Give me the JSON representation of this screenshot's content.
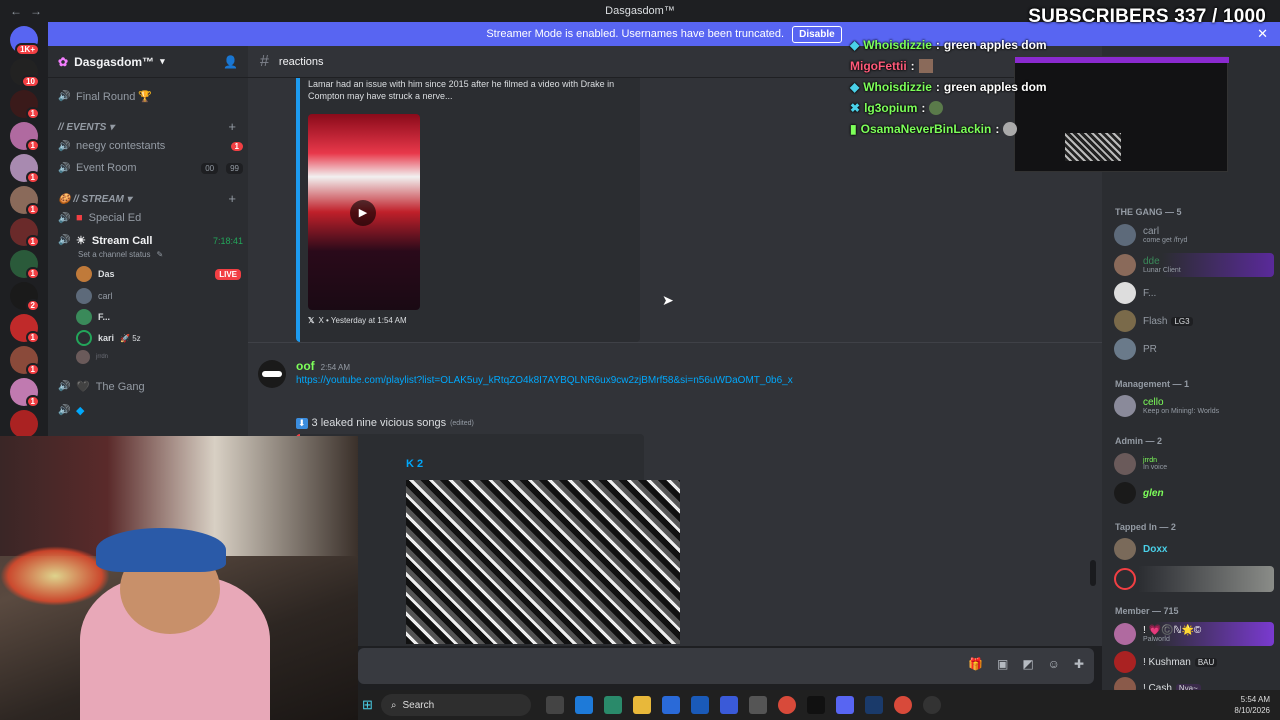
{
  "window": {
    "title": "Dasgasdom™"
  },
  "banner": {
    "text": "Streamer Mode is enabled. Usernames have been truncated.",
    "button": "Disable"
  },
  "overlay": {
    "subscribers": "SUBSCRIBERS 337 / 1000"
  },
  "rail": {
    "badges": [
      "1K+",
      "10",
      "1",
      "1",
      "1",
      "1",
      "1",
      "1",
      "2",
      "1",
      "1",
      "1",
      "2",
      "1",
      "1"
    ]
  },
  "server": {
    "name": "Dasgasdom™"
  },
  "channels": {
    "final_round": "Final Round 🏆",
    "events_cat": "// Events",
    "neegy": "neegy contestants",
    "neegy_badge": "1",
    "event_room": "Event Room",
    "event_room_count_a": "00",
    "event_room_count_b": "99",
    "stream_cat": "// STREAM",
    "special_ed": "Special Ed",
    "stream_call": "Stream Call",
    "stream_call_time": "7:18:41",
    "status_hint": "Set a channel status",
    "the_gang": "The Gang"
  },
  "voice_users": {
    "das": "Das",
    "live": "LIVE",
    "carl": "carl",
    "f": "F...",
    "kari": "kari",
    "kari_tag": "🚀 5z",
    "jrrdn": "jrrdn"
  },
  "chat": {
    "channel": "reactions",
    "embed_text_1": "Lamar had an issue with him since 2015 after he filmed a video with Drake in",
    "embed_text_2": "Compton may have struck a nerve...",
    "embed_footer": "X • Yesterday at 1:54 AM",
    "msg_author": "oof",
    "msg_time": "2:54 AM",
    "msg_link": "https://youtube.com/playlist?list=OLAK5uy_kRtqZO4k8I7AYBQLNR6ux9cw2zjBMrf58&si=n56uWDaOMT_0b6_x",
    "msg2_text": "3 leaked nine vicious songs",
    "msg2_edited": "(edited)",
    "embed2_title": "K 2"
  },
  "stream_chat": [
    {
      "user": "Whoisdizzie",
      "text": "green apples dom",
      "color": "#7dff5a"
    },
    {
      "user": "MigoFettii",
      "text": "",
      "color": "#ff5a7a"
    },
    {
      "user": "Whoisdizzie",
      "text": "green apples dom",
      "color": "#7dff5a"
    },
    {
      "user": "lg3opium",
      "text": "",
      "color": "#7dff5a"
    },
    {
      "user": "OsamaNeverBinLackin",
      "text": "",
      "color": "#7dff5a"
    }
  ],
  "members": {
    "gang_cat": "THE GANG — 5",
    "gang": [
      {
        "name": "carl",
        "sub": "come get /fryd"
      },
      {
        "name": "dde",
        "sub": "Lunar Client"
      },
      {
        "name": "F...",
        "sub": ""
      },
      {
        "name": "Flash",
        "sub": "LG3"
      },
      {
        "name": "PR",
        "sub": ""
      }
    ],
    "mgmt_cat": "Management — 1",
    "cello": "cello",
    "cello_sub": "Keep on Mining!: Worlds",
    "admin_cat": "Admin — 2",
    "jrrdn": "jrrdn",
    "jrrdn_sub": "In voice",
    "glen": "glen",
    "tapped_cat": "Tapped In — 2",
    "doxx": "Doxx",
    "member_cat": "Member — 715",
    "m1": "! 💗©️ℕ🌟©",
    "m1_sub": "Palworld",
    "m2": "! Kushman",
    "m2_tag": "BAU",
    "m3": "! Cash",
    "m3_tag": "Nya~"
  },
  "taskbar": {
    "search": "Search",
    "time": "5:54 AM",
    "date": "8/10/2026"
  },
  "colors": {
    "accent": "#5865f2",
    "danger": "#f23f43",
    "link": "#00a8fc",
    "green": "#23a55a"
  }
}
